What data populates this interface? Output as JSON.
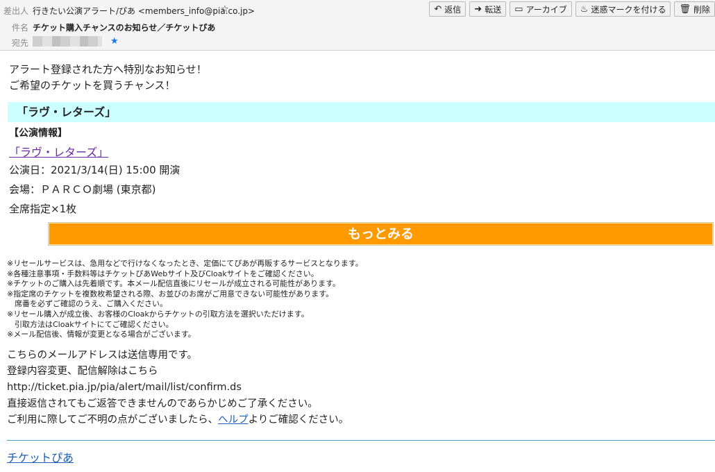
{
  "header": {
    "from_label": "差出人",
    "from_value": "行きたい公演アラート/ぴあ <members_info@pia.co.jp>",
    "subject_label": "件名",
    "subject_value": "チケット購入チャンスのお知らせ／チケットぴあ",
    "to_label": "宛先"
  },
  "toolbar": {
    "reply": "返信",
    "forward": "転送",
    "archive": "アーカイブ",
    "junk": "迷惑マークを付ける",
    "delete": "削除"
  },
  "message": {
    "intro1": "アラート登録された方へ特別なお知らせ！",
    "intro2": "ご希望のチケットを買うチャンス！",
    "event_title": "「ラヴ・レターズ」",
    "section_label": "【公演情報】",
    "event_link": "「ラヴ・レターズ」",
    "date": "公演日：2021/3/14(日) 15:00 開演",
    "venue": "会場：ＰＡＲＣＯ劇場 (東京都)",
    "seat": "全席指定×1枚",
    "more_button": "もっとみる",
    "notes": [
      "※リセールサービスは、急用などで行けなくなったとき、定価にてぴあが再販するサービスとなります。",
      "※各種注意事項・手数料等はチケットぴあWebサイト及びCloakサイトをご確認ください。",
      "※チケットのご購入は先着順です。本メール配信直後にリセールが成立される可能性があります。",
      "※指定席のチケットを複数枚希望される際、お並びのお席がご用意できない可能性があります。",
      "　席番を必ずご確認のうえ、ご購入ください。",
      "※リセール購入が成立後、お客様のCloakからチケットの引取方法を選択いただけます。",
      "　引取方法はCloakサイトにてご確認ください。",
      "※メール配信後、情報が変更となる場合がございます。"
    ],
    "footer1": "こちらのメールアドレスは送信専用です。",
    "footer2": "登録内容変更、配信解除はこちら",
    "footer_url": "http://ticket.pia.jp/pia/alert/mail/list/confirm.ds",
    "footer3": "直接返信されてもご返答できませんのであらかじめご了承ください。",
    "footer4_pre": "ご利用に際してご不明の点がございましたら、",
    "footer4_link": "ヘルプ",
    "footer4_post": "よりご確認ください。",
    "signature": "チケットぴあ"
  }
}
